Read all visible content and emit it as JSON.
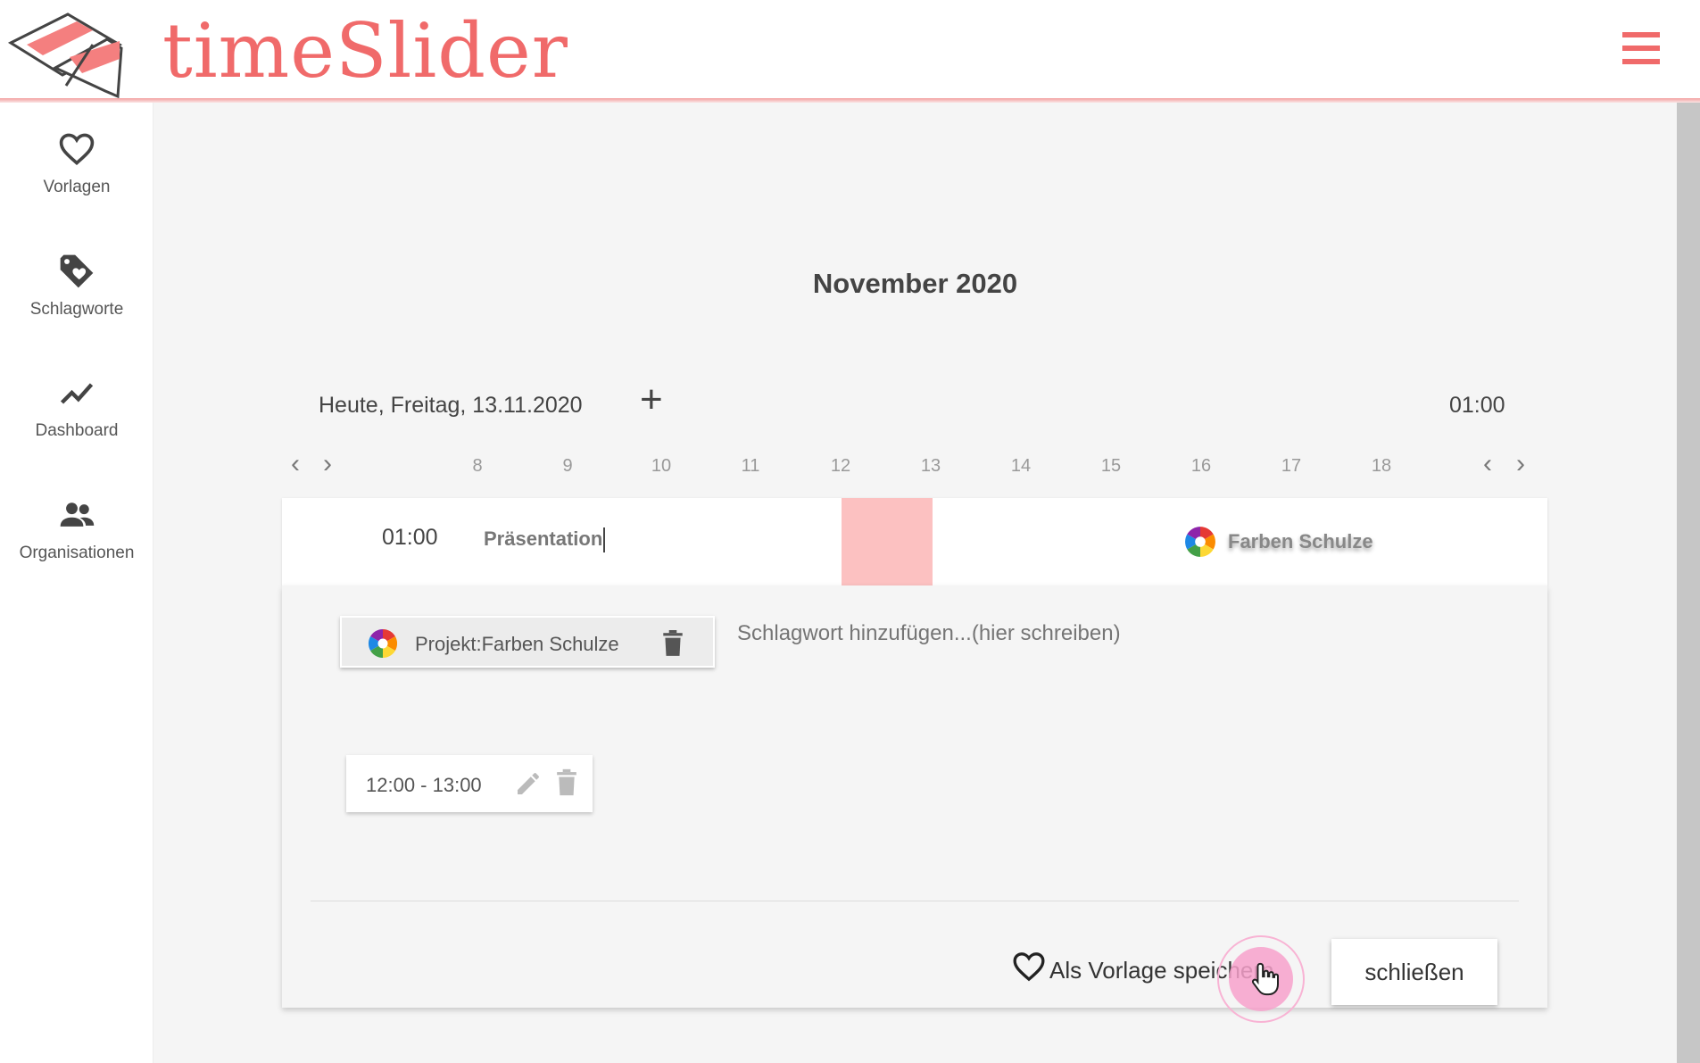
{
  "app": {
    "brand": "timeSlider",
    "accent_color": "#f06a6a",
    "menu_icon": "hamburger-icon"
  },
  "sidebar": {
    "items": [
      {
        "label": "Vorlagen",
        "icon": "heart-icon"
      },
      {
        "label": "Schlagworte",
        "icon": "tag-heart-icon"
      },
      {
        "label": "Dashboard",
        "icon": "trend-chart-icon"
      },
      {
        "label": "Organisationen",
        "icon": "people-icon"
      }
    ]
  },
  "calendar": {
    "month": "November 2020",
    "today": "Heute, Freitag, 13.11.2020",
    "add_symbol": "+",
    "total": "01:00",
    "prev_symbol": "‹",
    "next_symbol": "›",
    "hours": [
      "8",
      "9",
      "10",
      "11",
      "12",
      "13",
      "14",
      "15",
      "16",
      "17",
      "18"
    ]
  },
  "entry": {
    "duration": "01:00",
    "title": "Präsentation",
    "project": "Farben Schulze",
    "block_color": "#fcc1c1"
  },
  "detail": {
    "tag_label": "Projekt:Farben Schulze",
    "tag_placeholder": "Schlagwort hinzufügen...(hier schreiben)",
    "time_range": "12:00 - 13:00",
    "save_template": "Als Vorlage speichern",
    "close": "schließen"
  }
}
